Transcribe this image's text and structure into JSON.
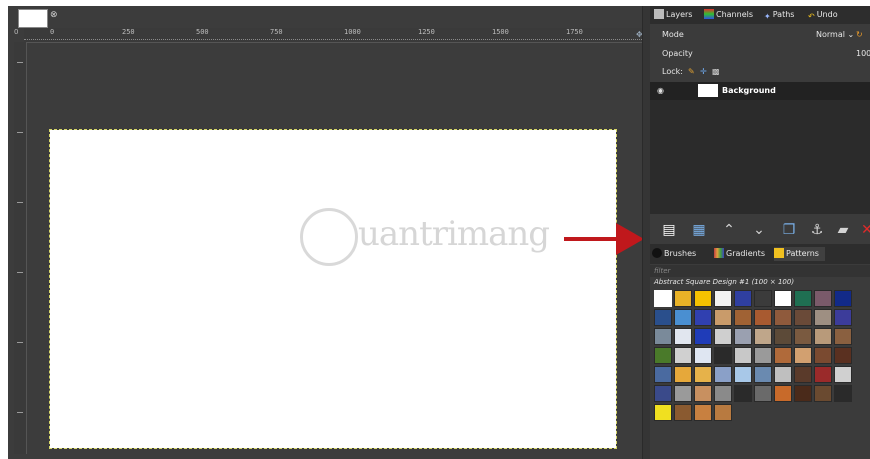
{
  "canvas_ruler": {
    "corner": "0",
    "ticks": [
      "0",
      "250",
      "500",
      "750",
      "1000",
      "1250",
      "1500",
      "1750"
    ]
  },
  "dock": {
    "tabs": [
      "Layers",
      "Channels",
      "Paths",
      "Undo"
    ],
    "mode_label": "Mode",
    "mode_value": "Normal",
    "opacity_label": "Opacity",
    "opacity_value": "100.0",
    "lock_label": "Lock:",
    "layers": [
      {
        "name": "Background",
        "visible": true
      }
    ]
  },
  "brushes_panel": {
    "tabs": [
      "Brushes",
      "Gradients",
      "Patterns"
    ],
    "filter_placeholder": "filter",
    "selected_pattern": "Abstract Square Design #1 (100 × 100)"
  },
  "watermark": {
    "text": "uantrimang"
  },
  "patterns": [
    "#ffffff",
    "#e9b227",
    "#f5c200",
    "#f2f2f2",
    "#2f3fa0",
    "#3b3b3b",
    "#ffffff",
    "#1f6f52",
    "#7a5a6a",
    "#122a88",
    "#2a4f8c",
    "#4a8fd1",
    "#3040b0",
    "#c99b6a",
    "#a06234",
    "#a85a30",
    "#8f5a3c",
    "#6a4a38",
    "#9e8f82",
    "#3c3c9a",
    "#7a8a9a",
    "#e1e6ef",
    "#1f3cb8",
    "#cfcfcf",
    "#9aa0b0",
    "#bfa68a",
    "#5c4a38",
    "#7a5a40",
    "#b89a7a",
    "#8a6040",
    "#4a7a2a",
    "#d0d0d0",
    "#dfe6f2",
    "#2a2a2a",
    "#c8c8c8",
    "#9a9a9a",
    "#b06a3a",
    "#d2a070",
    "#7a4a30",
    "#5a3020",
    "#4a6aa0",
    "#e6a83a",
    "#e6b24a",
    "#8aa0c8",
    "#a8c8e8",
    "#6a8ab0",
    "#bfbfbf",
    "#5a3a2a",
    "#9a2a2a",
    "#d0d0d0",
    "#3a4a8a",
    "#9a9a9a",
    "#c89060",
    "#8a8a8a",
    "#2a2a2a",
    "#6a6a6a",
    "#c86a2a",
    "#4a2a1a",
    "#6a4a30",
    "#2a2a2a",
    "#f0e020",
    "#8a5a30",
    "#c88040",
    "#b87a40"
  ],
  "colors": {
    "background": "#3c3c3c",
    "dock": "#3b3b3b",
    "arrow": "#c0181c",
    "accent_delete": "#e02a2a"
  }
}
